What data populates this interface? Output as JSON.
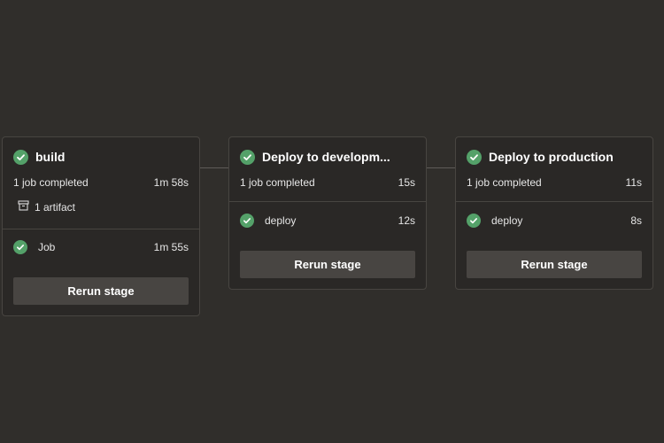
{
  "stages": [
    {
      "title": "build",
      "summary_text": "1 job completed",
      "summary_time": "1m 58s",
      "artifact_label": "1 artifact",
      "job": {
        "name": "Job",
        "time": "1m 55s"
      },
      "rerun_label": "Rerun stage"
    },
    {
      "title": "Deploy to developm...",
      "summary_text": "1 job completed",
      "summary_time": "15s",
      "job": {
        "name": "deploy",
        "time": "12s"
      },
      "rerun_label": "Rerun stage"
    },
    {
      "title": "Deploy to production",
      "summary_text": "1 job completed",
      "summary_time": "11s",
      "job": {
        "name": "deploy",
        "time": "8s"
      },
      "rerun_label": "Rerun stage"
    }
  ],
  "colors": {
    "background": "#302e2b",
    "card": "#2a2826",
    "border": "#484541",
    "success": "#54a169",
    "button": "#484542"
  },
  "icons": {
    "status": "check-circle-icon",
    "artifact": "artifact-icon"
  }
}
